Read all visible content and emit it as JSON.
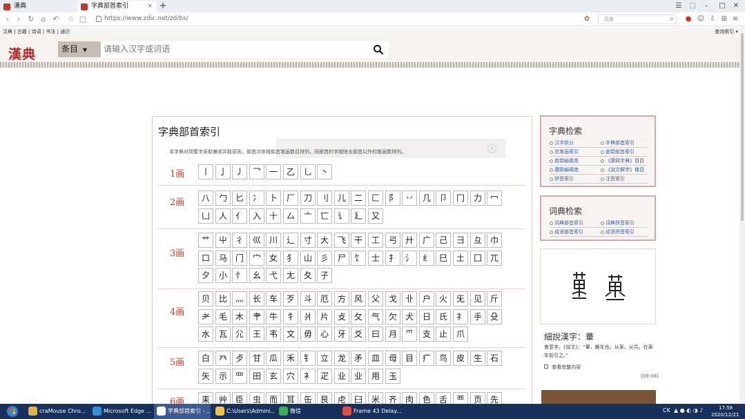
{
  "browser": {
    "tabs": [
      {
        "label": "漢典"
      },
      {
        "label": "字典部首索引"
      }
    ],
    "new_tab": "+",
    "url": "https://www.zdic.net/zd/bs/",
    "search_placeholder": "百度",
    "bookmarks_left": "汉典 | 古籍 | 诗词 | 书法 | 通识",
    "bookmarks_right": "查询索引 ▾"
  },
  "site": {
    "logo": "漢典",
    "search_dropdown": "条目",
    "search_placeholder": "请输入汉字或词语"
  },
  "main": {
    "title": "字典部首索引",
    "intro": "本字典对简繁字采取兼收并取原则，部首次序按部首笔画数目排列，同部首的字按除去部首以外的笔画数排列。",
    "rows": [
      {
        "label": "1画",
        "radicals": [
          "丨",
          "亅",
          "丿",
          "乛",
          "一",
          "乙",
          "乚",
          "丶"
        ]
      },
      {
        "label": "2画",
        "radicals": [
          "八",
          "勹",
          "匕",
          "冫",
          "卜",
          "厂",
          "刀",
          "刂",
          "儿",
          "二",
          "匚",
          "阝",
          "丷",
          "几",
          "卩",
          "冂",
          "力",
          "冖",
          "凵",
          "人",
          "亻",
          "入",
          "十",
          "厶",
          "亠",
          "匸",
          "讠",
          "廴",
          "又"
        ]
      },
      {
        "label": "3画",
        "radicals": [
          "艹",
          "屮",
          "彳",
          "巛",
          "川",
          "辶",
          "寸",
          "大",
          "飞",
          "干",
          "工",
          "弓",
          "廾",
          "广",
          "己",
          "彐",
          "彑",
          "巾",
          "口",
          "马",
          "门",
          "宀",
          "女",
          "犭",
          "山",
          "彡",
          "尸",
          "饣",
          "士",
          "扌",
          "氵",
          "纟",
          "巳",
          "土",
          "囗",
          "兀",
          "夕",
          "小",
          "忄",
          "幺",
          "弋",
          "尢",
          "夂",
          "子"
        ]
      },
      {
        "label": "4画",
        "radicals": [
          "贝",
          "比",
          "灬",
          "长",
          "车",
          "歹",
          "斗",
          "厄",
          "方",
          "风",
          "父",
          "戈",
          "卝",
          "户",
          "火",
          "旡",
          "见",
          "斤",
          "耂",
          "毛",
          "木",
          "肀",
          "牛",
          "牜",
          "爿",
          "片",
          "攴",
          "攵",
          "气",
          "欠",
          "犬",
          "日",
          "氏",
          "礻",
          "手",
          "殳",
          "水",
          "瓦",
          "尣",
          "王",
          "韦",
          "文",
          "毋",
          "心",
          "牙",
          "爻",
          "曰",
          "月",
          "爫",
          "支",
          "止",
          "爪"
        ]
      },
      {
        "label": "5画",
        "radicals": [
          "白",
          "癶",
          "歺",
          "甘",
          "瓜",
          "禾",
          "钅",
          "立",
          "龙",
          "矛",
          "皿",
          "母",
          "目",
          "疒",
          "鸟",
          "皮",
          "生",
          "石",
          "矢",
          "示",
          "罒",
          "田",
          "玄",
          "穴",
          "衤",
          "疋",
          "业",
          "业",
          "用",
          "玉"
        ]
      },
      {
        "label": "6画",
        "radicals": [
          "耒",
          "艸",
          "臣",
          "虫",
          "而",
          "耳",
          "缶",
          "艮",
          "虍",
          "臼",
          "米",
          "齐",
          "肉",
          "色",
          "舌",
          "覀",
          "页",
          "先"
        ]
      }
    ]
  },
  "sidebar": {
    "zidian_title": "字典检索",
    "zidian_links": [
      "汉字拆分",
      "字典部首索引",
      "总笔画索引",
      "倉頡部首索引",
      "倉頡編碼查",
      "《康熙字典》目目",
      "康熙編碼查",
      "《說文解字》楼目",
      "拼音索引",
      "注音索引"
    ],
    "cidian_title": "词典检索",
    "cidian_links": [
      "词典部首索引",
      "词典拼音索引",
      "成语部首索引",
      "成语拼音索引"
    ],
    "feature_title": "細說漢字：輂",
    "feature_body": "會意字。《說文》：“輂，輓车也。从車，从共。在車车前引之。”",
    "feature_more": "查看完整内容",
    "feature_date": "[09-08]"
  },
  "taskbar": {
    "apps": [
      {
        "label": "craMouse Chro...",
        "color": "#e8b13a"
      },
      {
        "label": "Microsoft Edge ...",
        "color": "#2f8fd8"
      },
      {
        "label": "字典部首索引 - ...",
        "color": "#ffffff"
      },
      {
        "label": "C:\\Users\\Admini...",
        "color": "#f0c24a"
      },
      {
        "label": "微信",
        "color": "#37b24d"
      },
      {
        "label": "Frame 43 Delay...",
        "color": "#e74c3c"
      }
    ],
    "tray": "CK",
    "time": "17:58",
    "date": "2020/12/21"
  },
  "colors": {
    "accent_red": "#c23b22",
    "header_bg": "#f5f3ef",
    "taskbar_bg": "#17305c",
    "sidebar_border": "#d7a9a4"
  }
}
